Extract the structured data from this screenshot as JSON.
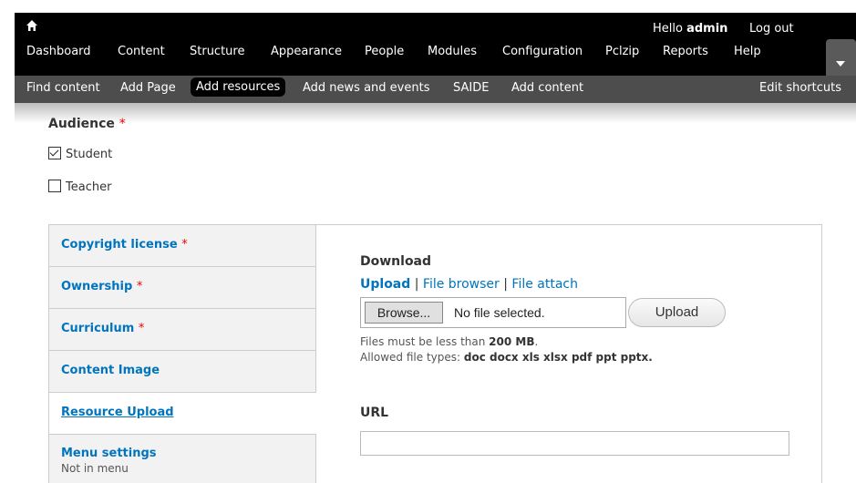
{
  "toolbar": {
    "home_icon": "home-icon",
    "greeting_prefix": "Hello ",
    "username": "admin",
    "logout": "Log out",
    "menu": [
      "Dashboard",
      "Content",
      "Structure",
      "Appearance",
      "People",
      "Modules",
      "Configuration",
      "Pclzip",
      "Reports",
      "Help"
    ]
  },
  "shortcuts": {
    "items": [
      "Find content",
      "Add Page",
      "Add resources",
      "Add news and events",
      "SAIDE",
      "Add content"
    ],
    "active": "Add resources",
    "edit": "Edit shortcuts"
  },
  "audience": {
    "label": "Audience",
    "required_mark": "*",
    "options": [
      {
        "label": "Student",
        "checked": true
      },
      {
        "label": "Teacher",
        "checked": false
      }
    ]
  },
  "tabs": [
    {
      "label": "Copyright license",
      "required": "*"
    },
    {
      "label": "Ownership",
      "required": "*"
    },
    {
      "label": "Curriculum",
      "required": "*"
    },
    {
      "label": "Content Image"
    },
    {
      "label": "Resource Upload",
      "active": true
    },
    {
      "label": "Menu settings",
      "summary": "Not in menu"
    }
  ],
  "download": {
    "title": "Download",
    "links": [
      "Upload",
      "File browser",
      "File attach"
    ],
    "link_separator": "|",
    "browse_button": "Browse...",
    "no_file": "No file selected.",
    "upload_button": "Upload",
    "size_prefix": "Files must be less than ",
    "size_value": "200 MB",
    "size_suffix": ".",
    "types_prefix": "Allowed file types: ",
    "types_value": "doc docx xls xlsx pdf ppt pptx."
  },
  "url": {
    "label": "URL",
    "value": ""
  },
  "colors": {
    "link": "#0074bd",
    "toolbar_bg": "#000000",
    "shortcuts_bg": "#4d4d4d",
    "required": "#ee0000"
  }
}
